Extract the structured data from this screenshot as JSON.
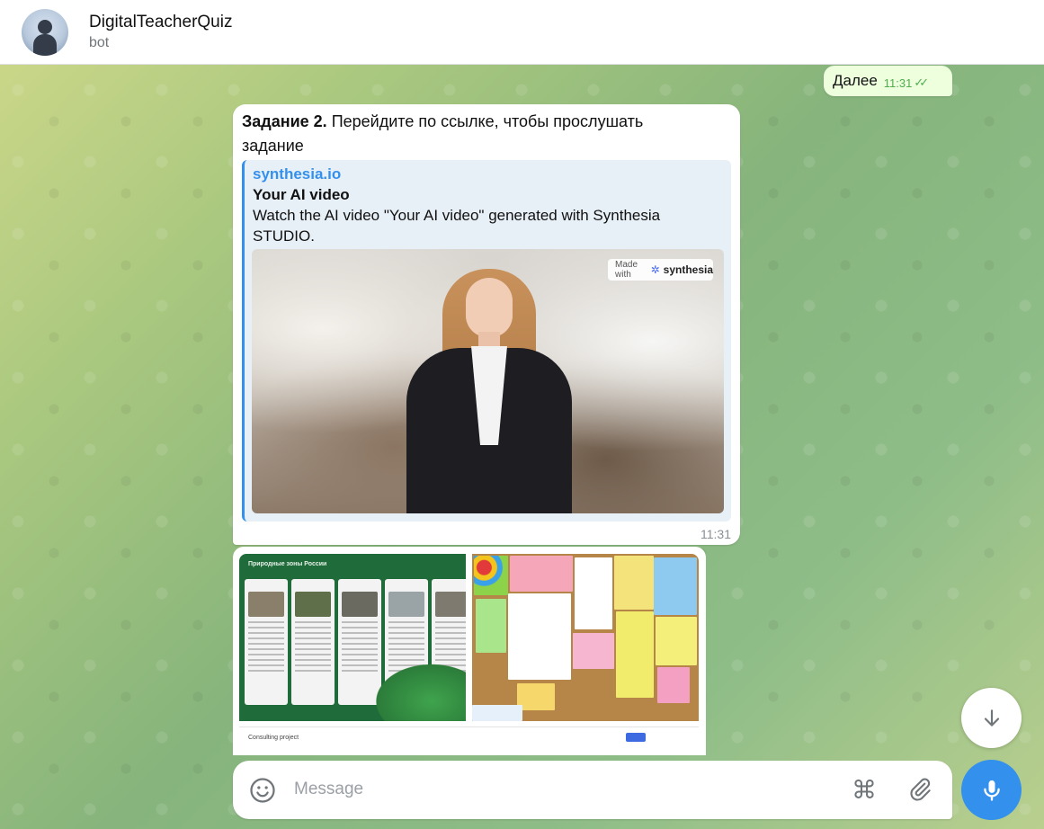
{
  "header": {
    "title": "DigitalTeacherQuiz",
    "subtitle": "bot"
  },
  "outgoing": {
    "text": "Далее",
    "time": "11:31"
  },
  "incoming": {
    "bold": "Задание 2.",
    "text": " Перейдите по ссылке, чтобы прослушать задание",
    "time": "11:31",
    "preview": {
      "site": "synthesia.io",
      "title": "Your AI video",
      "description": "Watch the AI video \"Your AI video\" generated with Synthesia STUDIO.",
      "badge_prefix": "Made with",
      "badge_brand": "synthesia"
    }
  },
  "album": {
    "thumb1_title": "Природные зоны России",
    "thumb3_bar": "Consulting project"
  },
  "composer": {
    "placeholder": "Message"
  },
  "icons": {
    "scroll": "arrow-down-icon",
    "emoji": "smiley-icon",
    "command": "command-icon",
    "attach": "paperclip-icon",
    "mic": "microphone-icon"
  },
  "colors": {
    "accent": "#3390ec",
    "outgoing_bubble": "#eeffde",
    "read_ticks": "#4fae4e"
  }
}
